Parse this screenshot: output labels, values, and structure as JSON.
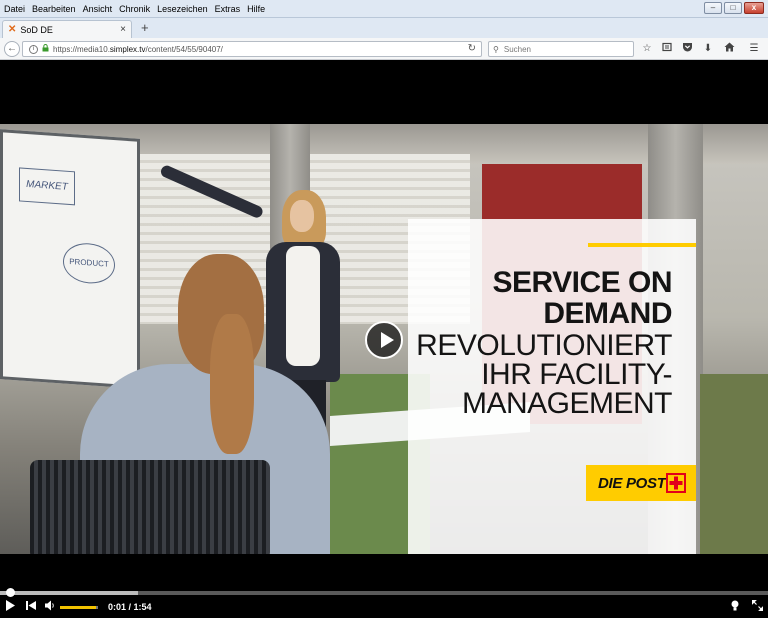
{
  "menu": [
    "Datei",
    "Bearbeiten",
    "Ansicht",
    "Chronik",
    "Lesezeichen",
    "Extras",
    "Hilfe"
  ],
  "window_controls": {
    "minimize": "–",
    "maximize": "□",
    "close": "x"
  },
  "tab": {
    "title": "SoD DE",
    "close": "×",
    "favicon_icon": "simplex-x-icon"
  },
  "new_tab": "+",
  "urlbar": {
    "prefix": "https://media10.",
    "domain": "simplex.tv",
    "path": "/content/54/55/90407/"
  },
  "search": {
    "placeholder": "Suchen"
  },
  "video": {
    "headline_bold": [
      "SERVICE ON",
      "DEMAND"
    ],
    "headline_regular": [
      "REVOLUTIONIERT",
      "IHR FACILITY-",
      "MANAGEMENT"
    ],
    "logo_text": "DIE POST",
    "flipchart_text_1": "MARKET",
    "flipchart_text_2": "PRODUCT"
  },
  "player": {
    "time": "0:01 / 1:54",
    "progress": 0.009,
    "buffered": 0.18,
    "volume": 0.95,
    "accent_color": "#f2c300"
  },
  "colors": {
    "post_yellow": "#ffcc00",
    "post_red": "#e2001a"
  }
}
